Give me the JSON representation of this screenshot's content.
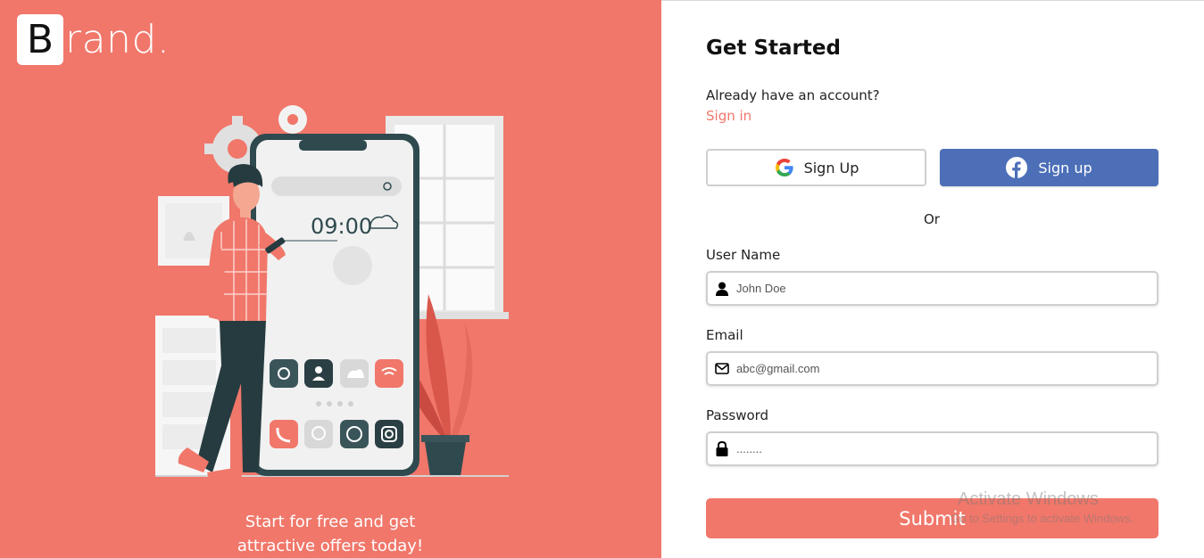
{
  "brand": {
    "initial": "B",
    "rest": "rand."
  },
  "left": {
    "tagline_line1": "Start for free and get",
    "tagline_line2": "attractive offers today!",
    "phone_time": "09:00"
  },
  "form": {
    "title": "Get Started",
    "already_text": "Already have an account?",
    "signin_link": "Sign in",
    "google_label": "Sign Up",
    "facebook_label": "Sign up",
    "or_text": "Or",
    "username": {
      "label": "User Name",
      "placeholder": "John Doe",
      "icon": "user-icon"
    },
    "email": {
      "label": "Email",
      "placeholder": "abc@gmail.com",
      "icon": "envelope-icon"
    },
    "password": {
      "label": "Password",
      "value": "........",
      "icon": "lock-icon"
    },
    "submit_label": "Submit"
  },
  "watermark": {
    "line1": "Activate Windows",
    "line2": "Go to Settings to activate Windows."
  },
  "colors": {
    "accent": "#f0776a",
    "facebook": "#4c6fb8",
    "phone_frame": "#2f4a4f"
  }
}
